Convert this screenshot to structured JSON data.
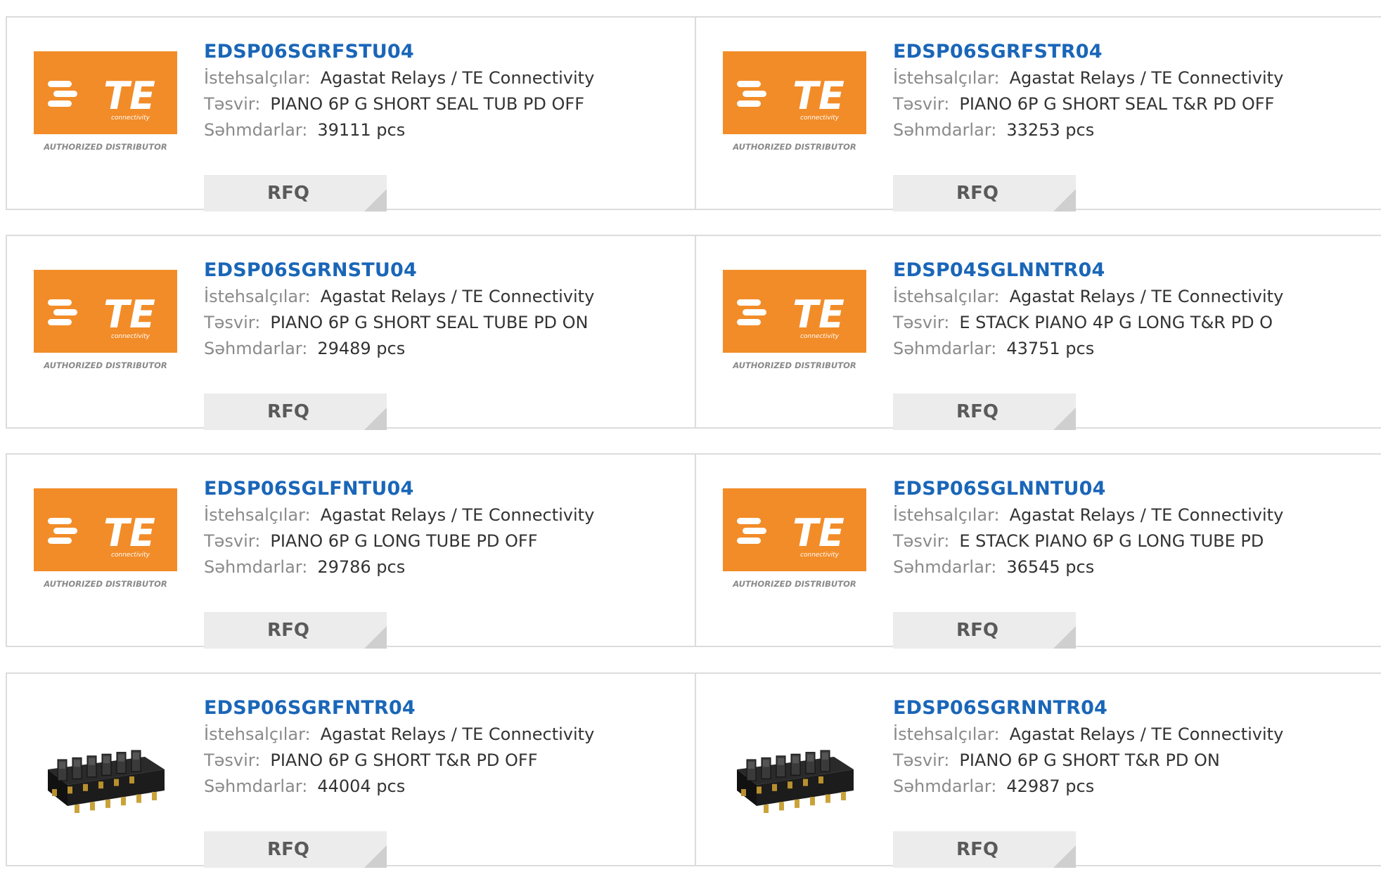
{
  "labels": {
    "manufacturer": "İstehsalçılar:",
    "description": "Təsvir:",
    "stock": "Səhmdarlar:",
    "rfq": "RFQ"
  },
  "logo": {
    "brand": "TE",
    "tagline": "connectivity",
    "caption": "AUTHORIZED DISTRIBUTOR",
    "color": "#f28c28"
  },
  "colors": {
    "link": "#1a66b8",
    "label": "#8a8a8a",
    "value": "#333333",
    "button_bg": "#ececec"
  },
  "products": [
    {
      "part": "EDSP06SGRFSTU04",
      "manufacturer": "Agastat Relays / TE Connectivity",
      "description": "PIANO 6P G SHORT SEAL TUB PD OFF",
      "stock": "39111 pcs",
      "image": "te-logo"
    },
    {
      "part": "EDSP06SGRFSTR04",
      "manufacturer": "Agastat Relays / TE Connectivity",
      "description": "PIANO 6P G SHORT SEAL T&R PD OFF",
      "stock": "33253 pcs",
      "image": "te-logo"
    },
    {
      "part": "EDSP06SGRNSTU04",
      "manufacturer": "Agastat Relays / TE Connectivity",
      "description": "PIANO 6P G SHORT SEAL TUBE PD ON",
      "stock": "29489 pcs",
      "image": "te-logo"
    },
    {
      "part": "EDSP04SGLNNTR04",
      "manufacturer": "Agastat Relays / TE Connectivity",
      "description": "E STACK PIANO 4P G LONG T&R PD O",
      "stock": "43751 pcs",
      "image": "te-logo"
    },
    {
      "part": "EDSP06SGLFNTU04",
      "manufacturer": "Agastat Relays / TE Connectivity",
      "description": "PIANO 6P G LONG TUBE PD OFF",
      "stock": "29786 pcs",
      "image": "te-logo"
    },
    {
      "part": "EDSP06SGLNNTU04",
      "manufacturer": "Agastat Relays / TE Connectivity",
      "description": "E STACK PIANO 6P G LONG TUBE PD",
      "stock": "36545 pcs",
      "image": "te-logo"
    },
    {
      "part": "EDSP06SGRFNTR04",
      "manufacturer": "Agastat Relays / TE Connectivity",
      "description": "PIANO 6P G SHORT T&R PD OFF",
      "stock": "44004 pcs",
      "image": "dip-switch"
    },
    {
      "part": "EDSP06SGRNNTR04",
      "manufacturer": "Agastat Relays / TE Connectivity",
      "description": "PIANO 6P G SHORT T&R PD ON",
      "stock": "42987 pcs",
      "image": "dip-switch"
    }
  ]
}
